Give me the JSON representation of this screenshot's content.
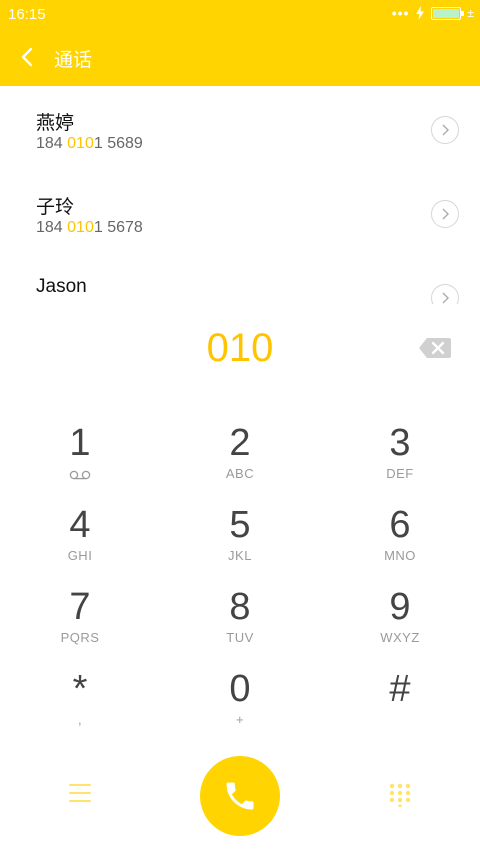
{
  "status": {
    "time": "16:15",
    "dots": "•••",
    "extra": "±"
  },
  "header": {
    "title": "通话"
  },
  "contacts": [
    {
      "name": "燕婷",
      "num_pre": "184 ",
      "num_hl": "010",
      "num_post": "1 5689"
    },
    {
      "name": "子玲",
      "num_pre": "184 ",
      "num_hl": "010",
      "num_post": "1 5678"
    },
    {
      "name": "Jason",
      "num_pre": "",
      "num_hl": "",
      "num_post": ""
    }
  ],
  "dial": {
    "number": "010"
  },
  "keys": [
    {
      "digit": "1",
      "letters": ""
    },
    {
      "digit": "2",
      "letters": "ABC"
    },
    {
      "digit": "3",
      "letters": "DEF"
    },
    {
      "digit": "4",
      "letters": "GHI"
    },
    {
      "digit": "5",
      "letters": "JKL"
    },
    {
      "digit": "6",
      "letters": "MNO"
    },
    {
      "digit": "7",
      "letters": "PQRS"
    },
    {
      "digit": "8",
      "letters": "TUV"
    },
    {
      "digit": "9",
      "letters": "WXYZ"
    },
    {
      "digit": "*",
      "letters": ","
    },
    {
      "digit": "0",
      "letters": "+"
    },
    {
      "digit": "#",
      "letters": ""
    }
  ],
  "colors": {
    "accent": "#FFD400",
    "highlight": "#FFC400"
  },
  "icons": {
    "back": "chevron-left-icon",
    "chevron": "chevron-right-icon",
    "backspace": "backspace-icon",
    "voicemail": "voicemail-icon",
    "menu": "menu-icon",
    "call": "phone-icon",
    "keypad": "keypad-icon"
  }
}
